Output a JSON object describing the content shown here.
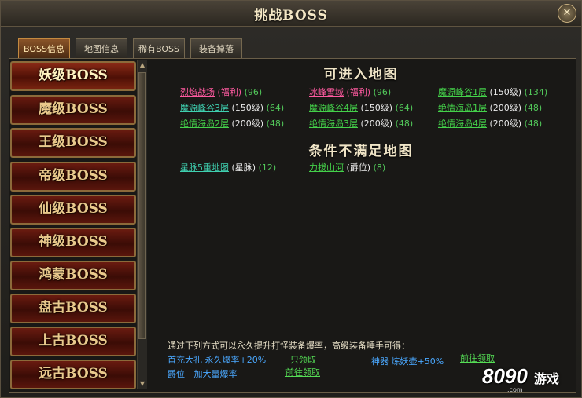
{
  "window": {
    "title": "挑战BOSS",
    "close_label": "✕"
  },
  "tabs": [
    {
      "label": "BOSS信息",
      "active": true
    },
    {
      "label": "地图信息",
      "active": false
    },
    {
      "label": "稀有BOSS",
      "active": false
    },
    {
      "label": "装备掉落",
      "active": false
    }
  ],
  "boss_list": [
    {
      "label": "妖级BOSS",
      "active": true
    },
    {
      "label": "魔级BOSS"
    },
    {
      "label": "王级BOSS"
    },
    {
      "label": "帝级BOSS"
    },
    {
      "label": "仙级BOSS"
    },
    {
      "label": "神级BOSS"
    },
    {
      "label": "鸿蒙BOSS"
    },
    {
      "label": "盘古BOSS"
    },
    {
      "label": "上古BOSS"
    },
    {
      "label": "远古BOSS"
    }
  ],
  "accessible_section": {
    "title": "可进入地图",
    "maps": [
      {
        "name": "烈焰战场",
        "tag": "(福利)",
        "count": "(96)",
        "name_color": "pink",
        "tag_color": "pink"
      },
      {
        "name": "冰峰雪域",
        "tag": "(福利)",
        "count": "(96)",
        "name_color": "pink",
        "tag_color": "pink"
      },
      {
        "name": "魔源峰谷1层",
        "tag": "(150级)",
        "count": "(134)",
        "name_color": "green",
        "tag_color": "white"
      },
      {
        "name": "魔源峰谷3层",
        "tag": "(150级)",
        "count": "(64)",
        "name_color": "cyan",
        "tag_color": "white"
      },
      {
        "name": "魔源峰谷4层",
        "tag": "(150级)",
        "count": "(64)",
        "name_color": "green",
        "tag_color": "white"
      },
      {
        "name": "绝情海岛1层",
        "tag": "(200级)",
        "count": "(48)",
        "name_color": "green",
        "tag_color": "white"
      },
      {
        "name": "绝情海岛2层",
        "tag": "(200级)",
        "count": "(48)",
        "name_color": "green",
        "tag_color": "white"
      },
      {
        "name": "绝情海岛3层",
        "tag": "(200级)",
        "count": "(48)",
        "name_color": "green",
        "tag_color": "white"
      },
      {
        "name": "绝情海岛4层",
        "tag": "(200级)",
        "count": "(48)",
        "name_color": "green",
        "tag_color": "white"
      }
    ]
  },
  "unqualified_section": {
    "title": "条件不满足地图",
    "maps": [
      {
        "name": "星脉5重地图",
        "tag": "(星脉)",
        "count": "(12)",
        "name_color": "cyan",
        "tag_color": "white"
      },
      {
        "name": "力拔山河",
        "tag": "(爵位)",
        "count": "(8)",
        "name_color": "green",
        "tag_color": "white"
      }
    ]
  },
  "bottom": {
    "note": "通过下列方式可以永久提升打怪装备爆率，高级装备唾手可得：",
    "first_recharge": "首充大礼",
    "permanent_rate": "永久爆率+20%",
    "claimed_only": "只领取",
    "artifact": "神器",
    "demon_pot": "炼妖壶+50%",
    "go_claim_1": "前往领取",
    "nobility": "爵位",
    "increase_rate": "加大量爆率",
    "go_claim_2": "前往领取"
  },
  "logo": {
    "digits": "8090",
    "cn": "游戏",
    "domain": ".com"
  },
  "colors": {
    "accent": "#c48a40",
    "green": "#44d14a",
    "pink": "#ff5aa0",
    "blue": "#4aa8ff"
  }
}
